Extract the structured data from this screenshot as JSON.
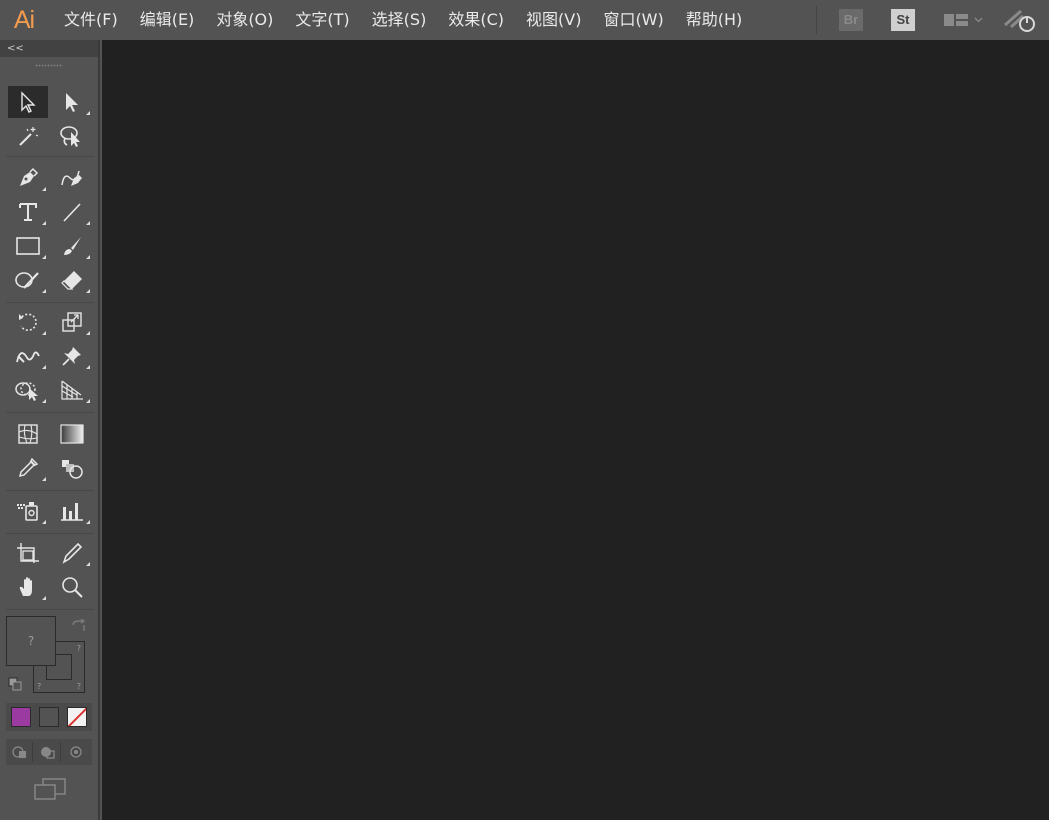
{
  "app": {
    "logo": "Ai"
  },
  "menu": {
    "items": [
      {
        "id": "file",
        "label": "文件(F)"
      },
      {
        "id": "edit",
        "label": "编辑(E)"
      },
      {
        "id": "object",
        "label": "对象(O)"
      },
      {
        "id": "type",
        "label": "文字(T)"
      },
      {
        "id": "select",
        "label": "选择(S)"
      },
      {
        "id": "effect",
        "label": "效果(C)"
      },
      {
        "id": "view",
        "label": "视图(V)"
      },
      {
        "id": "window",
        "label": "窗口(W)"
      },
      {
        "id": "help",
        "label": "帮助(H)"
      }
    ],
    "bridge_badge": "Br",
    "stock_badge": "St",
    "workspace_icon": "workspace-switcher-icon",
    "sync_icon": "sync-settings-icon"
  },
  "toolpanel": {
    "collapse_label": "<<",
    "fill_label": "?",
    "stroke_label_top": "?",
    "stroke_label_mid": "?",
    "stroke_label_bottom": "?",
    "colors": {
      "color_mode": "#9b3aa0",
      "none_slash": "#dd3333",
      "accent": "#F29B4F"
    }
  },
  "tools": [
    [
      "selection-tool",
      "direct-selection-tool"
    ],
    [
      "magic-wand-tool",
      "lasso-tool"
    ],
    [
      "pen-tool",
      "curvature-tool"
    ],
    [
      "type-tool",
      "line-segment-tool"
    ],
    [
      "rectangle-tool",
      "paintbrush-tool"
    ],
    [
      "shaper-tool",
      "eraser-tool"
    ],
    [
      "rotate-tool",
      "scale-tool"
    ],
    [
      "warp-tool",
      "puppet-warp-tool"
    ],
    [
      "shape-builder-tool",
      "perspective-grid-tool"
    ],
    [
      "mesh-tool",
      "gradient-tool"
    ],
    [
      "eyedropper-tool",
      "blend-tool"
    ],
    [
      "symbol-sprayer-tool",
      "column-graph-tool"
    ],
    [
      "artboard-tool",
      "slice-tool"
    ],
    [
      "hand-tool",
      "zoom-tool"
    ]
  ]
}
